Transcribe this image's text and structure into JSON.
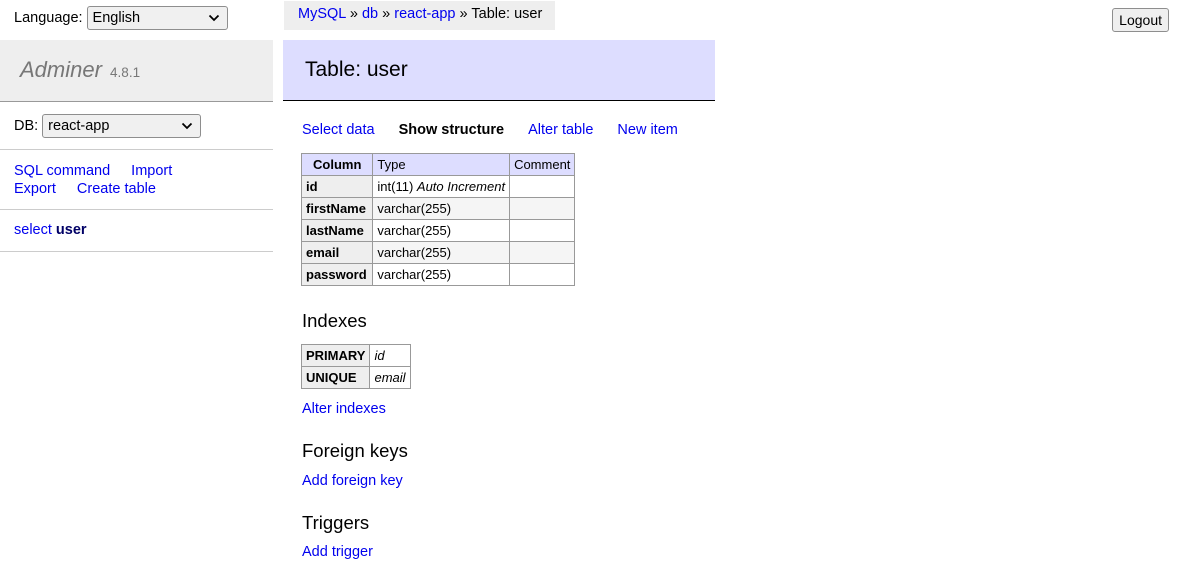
{
  "language": {
    "label": "Language:",
    "value": "English"
  },
  "logo": {
    "name": "Adminer",
    "version": "4.8.1"
  },
  "db": {
    "label": "DB:",
    "value": "react-app"
  },
  "menu_links": [
    "SQL command",
    "Import",
    "Export",
    "Create table"
  ],
  "select_table": {
    "prefix": "select",
    "name": "user"
  },
  "breadcrumb": {
    "items": [
      "MySQL",
      "db",
      "react-app"
    ],
    "sep": "»",
    "current": "Table: user"
  },
  "logout_label": "Logout",
  "page_title": "Table: user",
  "actions": [
    "Select data",
    "Show structure",
    "Alter table",
    "New item"
  ],
  "structure": {
    "headers": [
      "Column",
      "Type",
      "Comment"
    ],
    "rows": [
      {
        "name": "id",
        "type": "int(11)",
        "extra": "Auto Increment",
        "comment": ""
      },
      {
        "name": "firstName",
        "type": "varchar(255)",
        "extra": "",
        "comment": ""
      },
      {
        "name": "lastName",
        "type": "varchar(255)",
        "extra": "",
        "comment": ""
      },
      {
        "name": "email",
        "type": "varchar(255)",
        "extra": "",
        "comment": ""
      },
      {
        "name": "password",
        "type": "varchar(255)",
        "extra": "",
        "comment": ""
      }
    ]
  },
  "indexes": {
    "title": "Indexes",
    "rows": [
      {
        "type": "PRIMARY",
        "column": "id"
      },
      {
        "type": "UNIQUE",
        "column": "email"
      }
    ],
    "alter_link": "Alter indexes"
  },
  "foreign_keys": {
    "title": "Foreign keys",
    "add_link": "Add foreign key"
  },
  "triggers": {
    "title": "Triggers",
    "add_link": "Add trigger"
  }
}
